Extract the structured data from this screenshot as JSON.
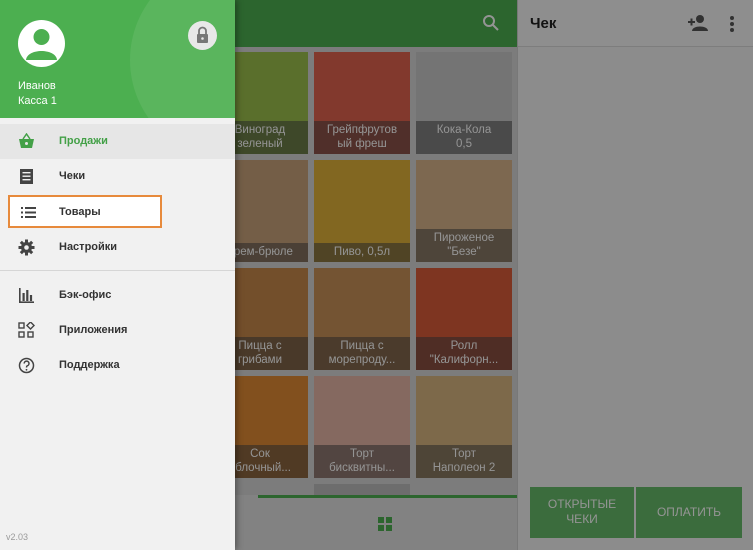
{
  "drawer": {
    "user_name": "Иванов",
    "register": "Касса 1",
    "menu": [
      {
        "label": "Продажи",
        "icon": "basket-icon"
      },
      {
        "label": "Чеки",
        "icon": "receipt-list-icon"
      },
      {
        "label": "Товары",
        "icon": "list-icon"
      },
      {
        "label": "Настройки",
        "icon": "gear-icon"
      },
      {
        "label": "Бэк-офис",
        "icon": "bar-chart-icon"
      },
      {
        "label": "Приложения",
        "icon": "apps-grid-icon"
      },
      {
        "label": "Поддержка",
        "icon": "help-icon"
      }
    ],
    "version": "v2.03"
  },
  "products": {
    "tiles": [
      {
        "name": "Виноград\nзеленый",
        "color": "#9bbf4c"
      },
      {
        "name": "Грейпфрутов\nый фреш",
        "color": "#e0634f"
      },
      {
        "name": "Кока-Кола\n0,5",
        "color": "#c8c8c8"
      },
      {
        "name": "Крем-брюле",
        "color": "#c9a27a"
      },
      {
        "name": "Пиво, 0,5л",
        "color": "#e0b23a"
      },
      {
        "name": "Пироженое\n\"Безе\"",
        "color": "#d8b48a"
      },
      {
        "name": "Пицца с\nгрибами",
        "color": "#c6884a"
      },
      {
        "name": "Пицца с\nморепроду...",
        "color": "#c99158"
      },
      {
        "name": "Ролл\n\"Калифорн...",
        "color": "#d95c3a"
      },
      {
        "name": "Сок\nяблочный...",
        "color": "#e08a35"
      },
      {
        "name": "Торт\nбисквитны...",
        "color": "#e6b6a6"
      },
      {
        "name": "Торт\nНаполеон 2",
        "color": "#d8b580"
      }
    ]
  },
  "receipt": {
    "title": "Чек",
    "open_checks_label": "ОТКРЫТЫЕ\nЧЕКИ",
    "pay_label": "ОПЛАТИТЬ"
  },
  "colors": {
    "accent": "#4caf50",
    "highlight_border": "#e78a3c"
  }
}
